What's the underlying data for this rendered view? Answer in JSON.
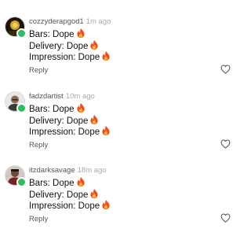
{
  "comments": [
    {
      "username": "cozzyderapgod1",
      "time": "1m ago",
      "lines": [
        {
          "text": "Bars: Dope",
          "emoji": "fire"
        },
        {
          "text": "Delivery: Dope",
          "emoji": "fire"
        },
        {
          "text": "Impression: Dope",
          "emoji": "fire"
        }
      ],
      "reply_label": "Reply",
      "online": true
    },
    {
      "username": "fadzdartist",
      "time": "10m ago",
      "lines": [
        {
          "text": "Bars: Dope",
          "emoji": "fire"
        },
        {
          "text": "Delivery: Dope",
          "emoji": "fire"
        },
        {
          "text": "Impression: Dope",
          "emoji": "fire"
        }
      ],
      "reply_label": "Reply",
      "online": true
    },
    {
      "username": "itzdarksavage",
      "time": "18m ago",
      "lines": [
        {
          "text": "Bars: Dope",
          "emoji": "fire"
        },
        {
          "text": "Delivery: Dope",
          "emoji": "fire"
        },
        {
          "text": "Impression: Dope",
          "emoji": "fire"
        }
      ],
      "reply_label": "Reply",
      "online": true
    }
  ],
  "colors": {
    "online": "#2dbe60",
    "timestamp": "#a8a8a8",
    "username": "#555555"
  }
}
